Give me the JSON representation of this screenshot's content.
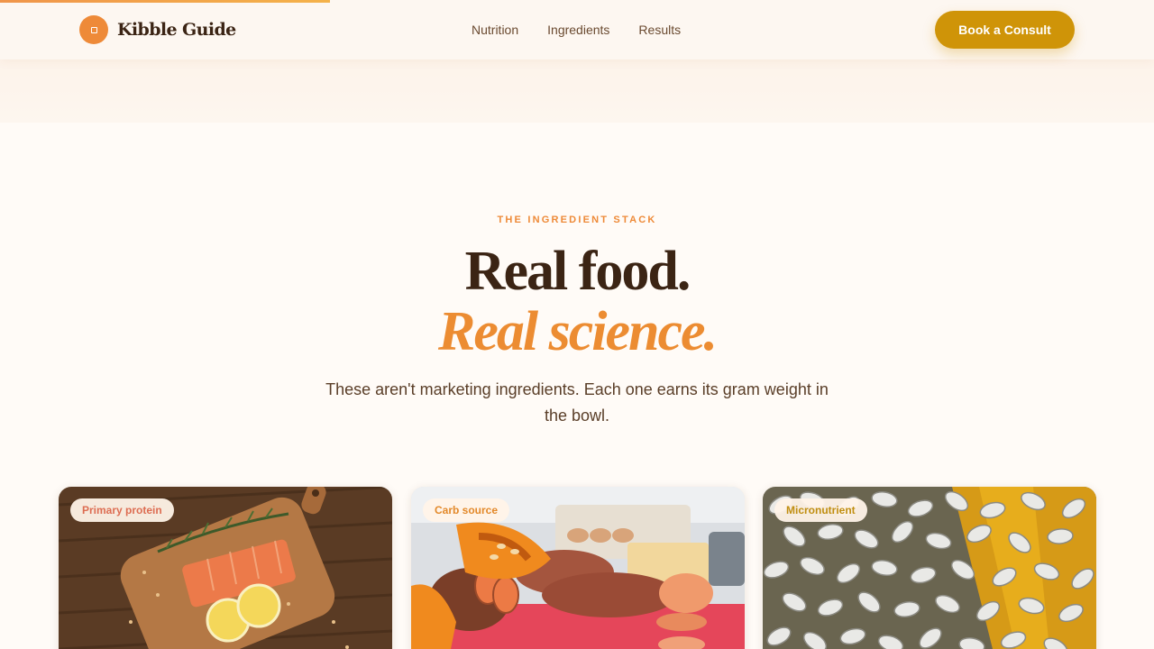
{
  "header": {
    "brand": "Kibble Guide",
    "nav": [
      "Nutrition",
      "Ingredients",
      "Results"
    ],
    "cta": "Book a Consult"
  },
  "hero": {
    "eyebrow": "THE INGREDIENT STACK",
    "title_line1": "Real food.",
    "title_line2": "Real science.",
    "subtitle": "These aren't marketing ingredients. Each one earns its gram weight in the bowl."
  },
  "cards": [
    {
      "badge": "Primary protein",
      "image": "salmon on cutting board"
    },
    {
      "badge": "Carb source",
      "image": "sweet potatoes and squash"
    },
    {
      "badge": "Micronutrient",
      "image": "pumpkin seeds"
    }
  ],
  "colors": {
    "accent_orange": "#ee8a38",
    "cta_gold": "#cf9408",
    "text_brown": "#3b2414"
  }
}
